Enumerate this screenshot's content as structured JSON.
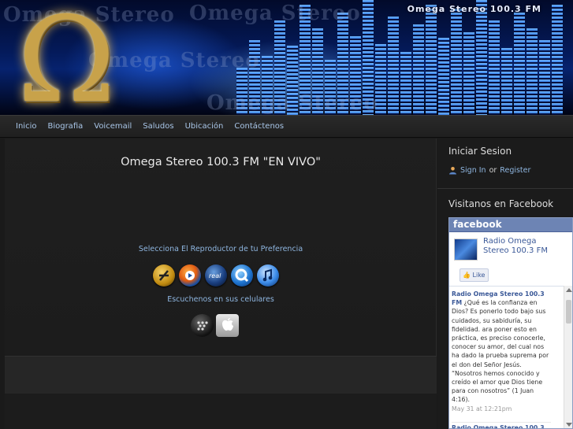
{
  "header": {
    "station_title": "Omega Stereo 100.3 FM",
    "watermark_1": "Omega Stereo",
    "watermark_2": "Omega Stereo",
    "watermark_3": "Omega Stereo",
    "watermark_4": "Omega Stereo"
  },
  "nav": {
    "items": [
      {
        "label": "Inicio"
      },
      {
        "label": "Biografia"
      },
      {
        "label": "Voicemail"
      },
      {
        "label": "Saludos"
      },
      {
        "label": "Ubicación"
      },
      {
        "label": "Contáctenos"
      }
    ]
  },
  "main": {
    "title": "Omega Stereo 100.3 FM \"EN VIVO\"",
    "select_text": "Selecciona El Reproductor de tu Preferencia",
    "players": [
      "winamp-icon",
      "windows-media-player-icon",
      "realplayer-icon",
      "quicktime-icon",
      "itunes-icon"
    ],
    "mobile_text": "Escuchenos en sus celulares",
    "mobile": [
      "blackberry-icon",
      "apple-icon"
    ]
  },
  "sidebar": {
    "login_heading": "Iniciar Sesion",
    "sign_in": "Sign In",
    "or": "or",
    "register": "Register",
    "facebook_heading": "Visitanos en Facebook"
  },
  "facebook": {
    "brand": "facebook",
    "page_name": "Radio Omega Stereo 100.3 FM",
    "like_label": "Like",
    "post_author": "Radio Omega Stereo 100.3 FM",
    "post_text": "¿Qué es la confianza en Dios? Es ponerlo todo bajo sus cuidados, su sabiduría, su fidelidad. ara poner esto en práctica, es preciso conocerle, conocer su amor, del cual nos ha dado la prueba suprema por el don del Señor Jesús. “Nosotros hemos conocido y creído el amor que Dios tiene para con nosotros” (1 Juan 4:16).",
    "post_time": "May 31 at 12:21pm",
    "next_post_author": "Radio Omega Stereo 100.3"
  },
  "colors": {
    "link": "#8fb6e0",
    "facebook_blue": "#3b5998",
    "background": "#1c1c1c"
  }
}
